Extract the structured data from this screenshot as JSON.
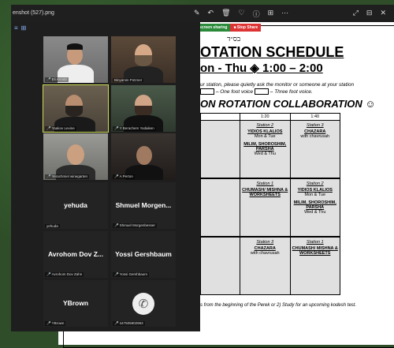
{
  "viewer": {
    "filename": "enshot (527).png",
    "tools": [
      "✎",
      "↶",
      "🗑",
      "♡",
      "ⓘ",
      "⊞",
      "⋯"
    ],
    "right_tools": [
      "⤢",
      "⊟",
      "✕"
    ]
  },
  "share": {
    "sharing_label": "are screen sharing",
    "stop_label": "■ Stop Share"
  },
  "doc": {
    "bsd": "בס״ד",
    "title1": "OTATION SCHEDULE",
    "title2": "on - Thu ◈ 1:00 – 2:00",
    "instr_line1": "ur station, please quietly ask the monitor or someone at your station",
    "instr_line2_a": "– One foot voice",
    "instr_line2_b": "– Three foot voice.",
    "collab": "ON ROTATION COLLABORATION ☺",
    "headers": [
      "",
      "1:20",
      "1:40"
    ],
    "rows": [
      {
        "c1": {
          "station": "Station 2",
          "a": "YIDIOS KLALIOS",
          "a_sub": "Mon & Tue",
          "b": "MILIM, SHOROSHIM, PARSHA",
          "b_sub": "Wed & Thu"
        },
        "c2": {
          "station": "Station 3",
          "a": "CHAZARA",
          "a_sub": "with chavrusah",
          "b": "",
          "b_sub": ""
        }
      },
      {
        "c1": {
          "station": "Station 1",
          "a": "CHUMASH/ MISHNA & WORKSHEETS",
          "a_sub": "",
          "b": "",
          "b_sub": ""
        },
        "c2": {
          "station": "Station 2",
          "a": "YIDIOS KLALIOS",
          "a_sub": "Mon & Tue",
          "b": "MILIM, SHOROSHIM, PARSHA",
          "b_sub": "Wed & Thu"
        }
      },
      {
        "c1": {
          "station": "Station 3",
          "a": "CHAZARA",
          "a_sub": "with chavrusah",
          "b": "",
          "b_sub": ""
        },
        "c2": {
          "station": "Station 1",
          "a": "CHUMASH/ MISHNA & WORKSHEETS",
          "a_sub": "",
          "b": "",
          "b_sub": ""
        }
      }
    ],
    "footnote": "s from the beginning of the Perek or 2) Study for an upcoming kodesh test."
  },
  "zoom": {
    "tiles": [
      {
        "name": "Eli Arnold",
        "big": "",
        "video": true,
        "muted": true
      },
      {
        "name": "Binyamin Potzner",
        "big": "",
        "video": true,
        "muted": false
      },
      {
        "name": "Yaakov Levine",
        "big": "",
        "video": true,
        "muted": true
      },
      {
        "name": "Y Berachem Yodaiken",
        "big": "",
        "video": true,
        "muted": true
      },
      {
        "name": "Yerachmiel winegarten",
        "big": "",
        "video": true,
        "muted": true
      },
      {
        "name": "A Perton",
        "big": "",
        "video": true,
        "muted": true
      },
      {
        "name": "yehuda",
        "big": "yehuda",
        "video": false,
        "muted": false
      },
      {
        "name": "Shmuel Morgenbesser",
        "big": "Shmuel Morgen...",
        "video": false,
        "muted": true
      },
      {
        "name": "Avrohom Dov Zahn",
        "big": "Avrohom Dov Z...",
        "video": false,
        "muted": true
      },
      {
        "name": "Yossi Gershbaum",
        "big": "Yossi Gershbaum",
        "video": false,
        "muted": true
      },
      {
        "name": "YBrown",
        "big": "YBrown",
        "video": false,
        "muted": true
      },
      {
        "name": "447505902963",
        "big": "",
        "video": false,
        "muted": true
      }
    ]
  }
}
